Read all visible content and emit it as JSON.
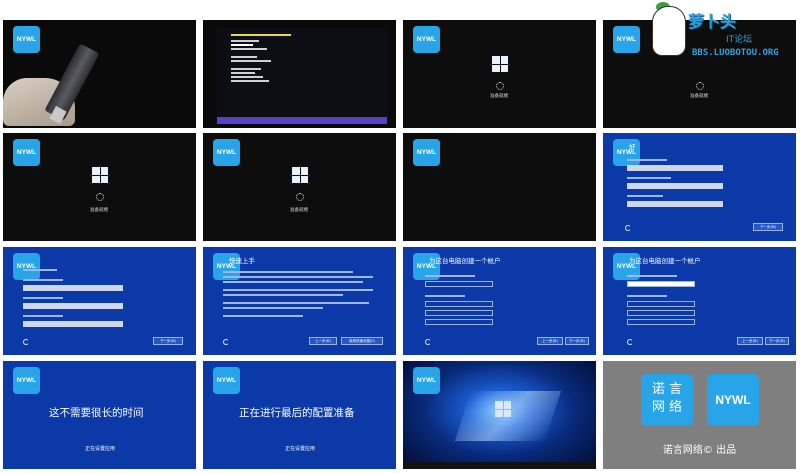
{
  "header": {
    "lines": [
      "",
      "",
      "",
      "",
      ""
    ]
  },
  "brand": {
    "badge": "NYWL",
    "cn_mark": "诺 言\n网 络",
    "en_mark": "NYWL",
    "credit": "诺言网络© 出品"
  },
  "watermark": {
    "title": "萝卜头",
    "sub": "IT论坛",
    "url": "BBS.LUOBOTOU.ORG"
  },
  "frames": {
    "boot_caption": "准备就绪",
    "oobe_title_region": "区域设置",
    "oobe_partial_title": "好",
    "oobe_quick_title": "快速上手",
    "oobe_account_title": "为这台电脑创建一个帐户",
    "next_button": "下一步(N)",
    "back_button": "上一步(B)",
    "use_express": "使用快速设置(E)",
    "msg_not_long": "这不需要很长的时间",
    "msg_final_config": "正在进行最后的配置准备",
    "msg_setting_apps": "正在设置应用"
  },
  "colors": {
    "setup_blue": "#0b3aa8",
    "brand_blue": "#27a5e8",
    "bios_purple": "#5a3fc7"
  }
}
